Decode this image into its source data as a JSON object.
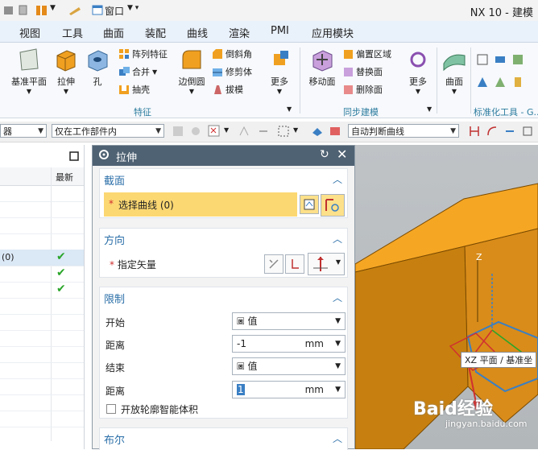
{
  "app": {
    "title": "NX 10 - 建模"
  },
  "quick_access": {
    "window_label": "窗口"
  },
  "menu": {
    "tabs": [
      "视图",
      "工具",
      "曲面",
      "装配",
      "曲线",
      "渲染",
      "PMI",
      "应用模块"
    ]
  },
  "ribbon": {
    "feature_group": {
      "label": "特征",
      "datum_plane": "基准平面",
      "extrude": "拉伸",
      "hole": "孔",
      "pattern_feature": "阵列特征",
      "unite": "合并",
      "shell": "抽壳",
      "edge_blend": "边倒圆",
      "chamfer": "倒斜角",
      "trim_body": "修剪体",
      "draft": "拔模",
      "more": "更多"
    },
    "sync_group": {
      "label": "同步建模",
      "move_face": "移动面",
      "offset_region": "偏置区域",
      "replace_face": "替换面",
      "delete_face": "删除面",
      "more": "更多"
    },
    "surface_group": {
      "surface": "曲面"
    },
    "standard_tools_label": "标准化工具 - G..."
  },
  "selection_bar": {
    "filter_left": "器",
    "scope": "仅在工作部件内",
    "curve_rule": "自动判断曲线"
  },
  "navigator": {
    "column_latest": "最新",
    "selected_row_text": "(0)"
  },
  "dialog": {
    "title": "拉伸",
    "section_label": "截面",
    "select_curve": "选择曲线 (0)",
    "direction_label": "方向",
    "specify_vector": "指定矢量",
    "limits_label": "限制",
    "start_label": "开始",
    "start_value": "值",
    "start_distance_label": "距离",
    "start_distance": "-1",
    "start_unit": "mm",
    "end_label": "结束",
    "end_value": "值",
    "end_distance_label": "距离",
    "end_distance": "1",
    "end_unit": "mm",
    "open_profile": "开放轮廓智能体积",
    "boolean_label": "布尔"
  },
  "viewport": {
    "axis_label": "Z",
    "plane_tooltip": "XZ 平面 / 基准坐",
    "watermark": "Baid经验",
    "watermark_sub": "jingyan.baidu.com"
  },
  "colors": {
    "dialog_title_bg": "#4f6273",
    "section_header": "#2b6fa8",
    "highlight_select": "#fcd873",
    "solid_orange": "#f0a020",
    "check_green": "#2aa52a"
  }
}
